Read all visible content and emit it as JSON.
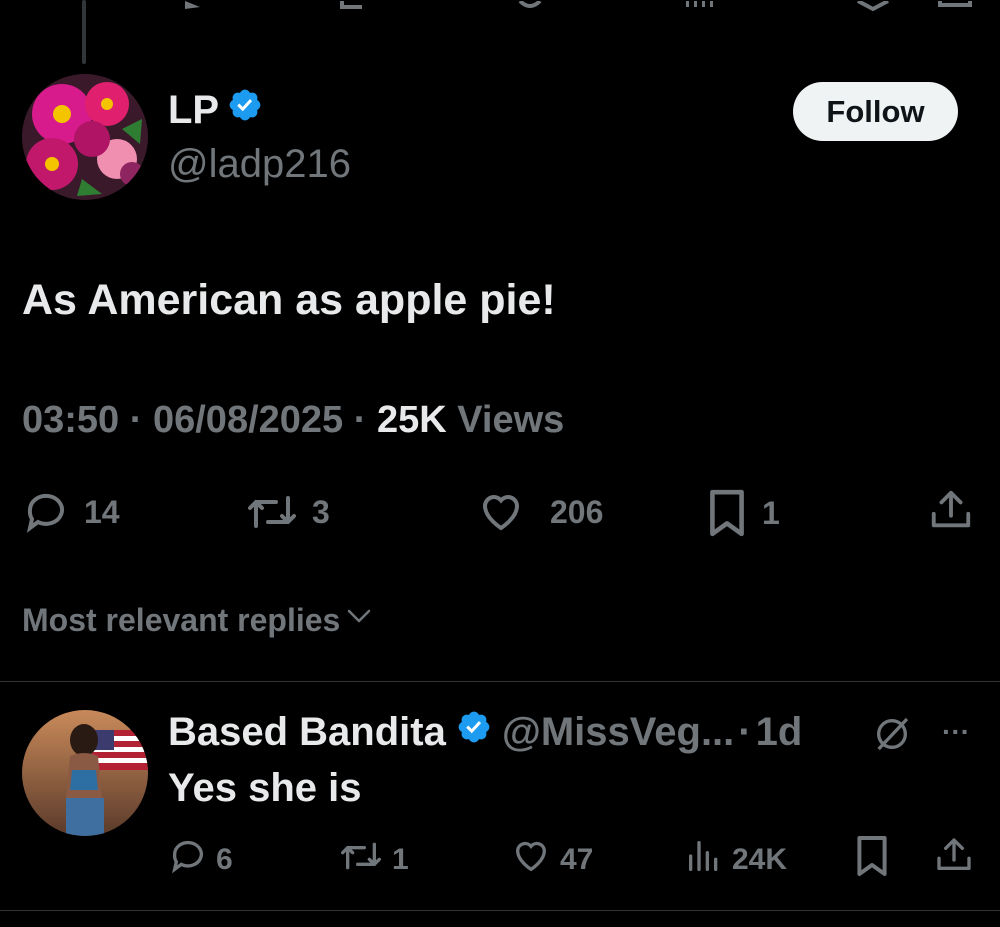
{
  "main_tweet": {
    "name": "LP",
    "handle": "@ladp216",
    "verified": true,
    "follow_label": "Follow",
    "text": "As American as apple pie!",
    "time": "03:50",
    "date": "06/08/2025",
    "views_count": "25K",
    "views_label": "Views",
    "separator": "·",
    "actions": {
      "replies": "14",
      "reposts": "3",
      "likes": "206",
      "bookmarks": "1"
    }
  },
  "replies_sort": {
    "label": "Most relevant replies"
  },
  "reply": {
    "name": "Based Bandita",
    "verified": true,
    "handle": "@MissVeg...",
    "separator": "·",
    "age": "1d",
    "text": "Yes she is",
    "more_label": "···",
    "actions": {
      "replies": "6",
      "reposts": "1",
      "likes": "47",
      "views": "24K"
    }
  },
  "colors": {
    "background": "#000000",
    "text_primary": "#e7e9ea",
    "text_secondary": "#71767b",
    "verified_blue": "#1d9bf0",
    "divider": "#2f3336",
    "follow_bg": "#eff3f4"
  }
}
